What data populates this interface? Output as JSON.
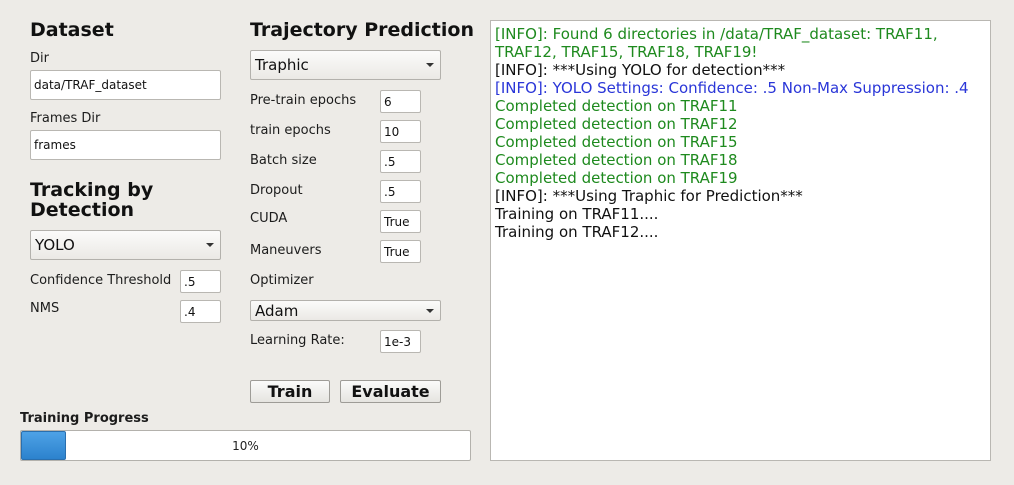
{
  "dataset": {
    "heading": "Dataset",
    "dir_label": "Dir",
    "dir_value": "data/TRAF_dataset",
    "frames_dir_label": "Frames Dir",
    "frames_dir_value": "frames"
  },
  "tracking": {
    "heading": "Tracking by Detection",
    "detector_selected": "YOLO",
    "confidence_label": "Confidence Threshold",
    "confidence_value": ".5",
    "nms_label": "NMS",
    "nms_value": ".4"
  },
  "prediction": {
    "heading": "Trajectory Prediction",
    "model_selected": "Traphic",
    "pretrain_epochs_label": "Pre-train epochs",
    "pretrain_epochs_value": "6",
    "train_epochs_label": "train epochs",
    "train_epochs_value": "10",
    "batch_size_label": "Batch size",
    "batch_size_value": ".5",
    "dropout_label": "Dropout",
    "dropout_value": ".5",
    "cuda_label": "CUDA",
    "cuda_value": "True",
    "maneuvers_label": "Maneuvers",
    "maneuvers_value": "True",
    "optimizer_label": "Optimizer",
    "optimizer_selected": "Adam",
    "learning_rate_label": "Learning Rate:",
    "learning_rate_value": "1e-3",
    "train_button": "Train",
    "evaluate_button": "Evaluate"
  },
  "training_progress": {
    "label": "Training Progress",
    "percent_text": "10%",
    "fraction": 0.1
  },
  "log": {
    "lines": [
      {
        "text": "[INFO]: Found 6 directories in /data/TRAF_dataset: TRAF11, TRAF12, TRAF15, TRAF18, TRAF19!",
        "color": "#1e8a1e"
      },
      {
        "text": "[INFO]: ***Using YOLO for detection***",
        "color": "#111111"
      },
      {
        "text": "[INFO]: YOLO Settings: Confidence: .5 Non-Max Suppression: .4",
        "color": "#2a36d8"
      },
      {
        "text": "Completed detection on TRAF11",
        "color": "#1e8a1e"
      },
      {
        "text": "Completed detection on TRAF12",
        "color": "#1e8a1e"
      },
      {
        "text": "Completed detection on TRAF15",
        "color": "#1e8a1e"
      },
      {
        "text": "Completed detection on TRAF18",
        "color": "#1e8a1e"
      },
      {
        "text": "Completed detection on TRAF19",
        "color": "#1e8a1e"
      },
      {
        "text": "[INFO]: ***Using Traphic for Prediction***",
        "color": "#111111"
      },
      {
        "text": "Training on TRAF11....",
        "color": "#111111"
      },
      {
        "text": "Training on TRAF12....",
        "color": "#111111"
      }
    ]
  }
}
